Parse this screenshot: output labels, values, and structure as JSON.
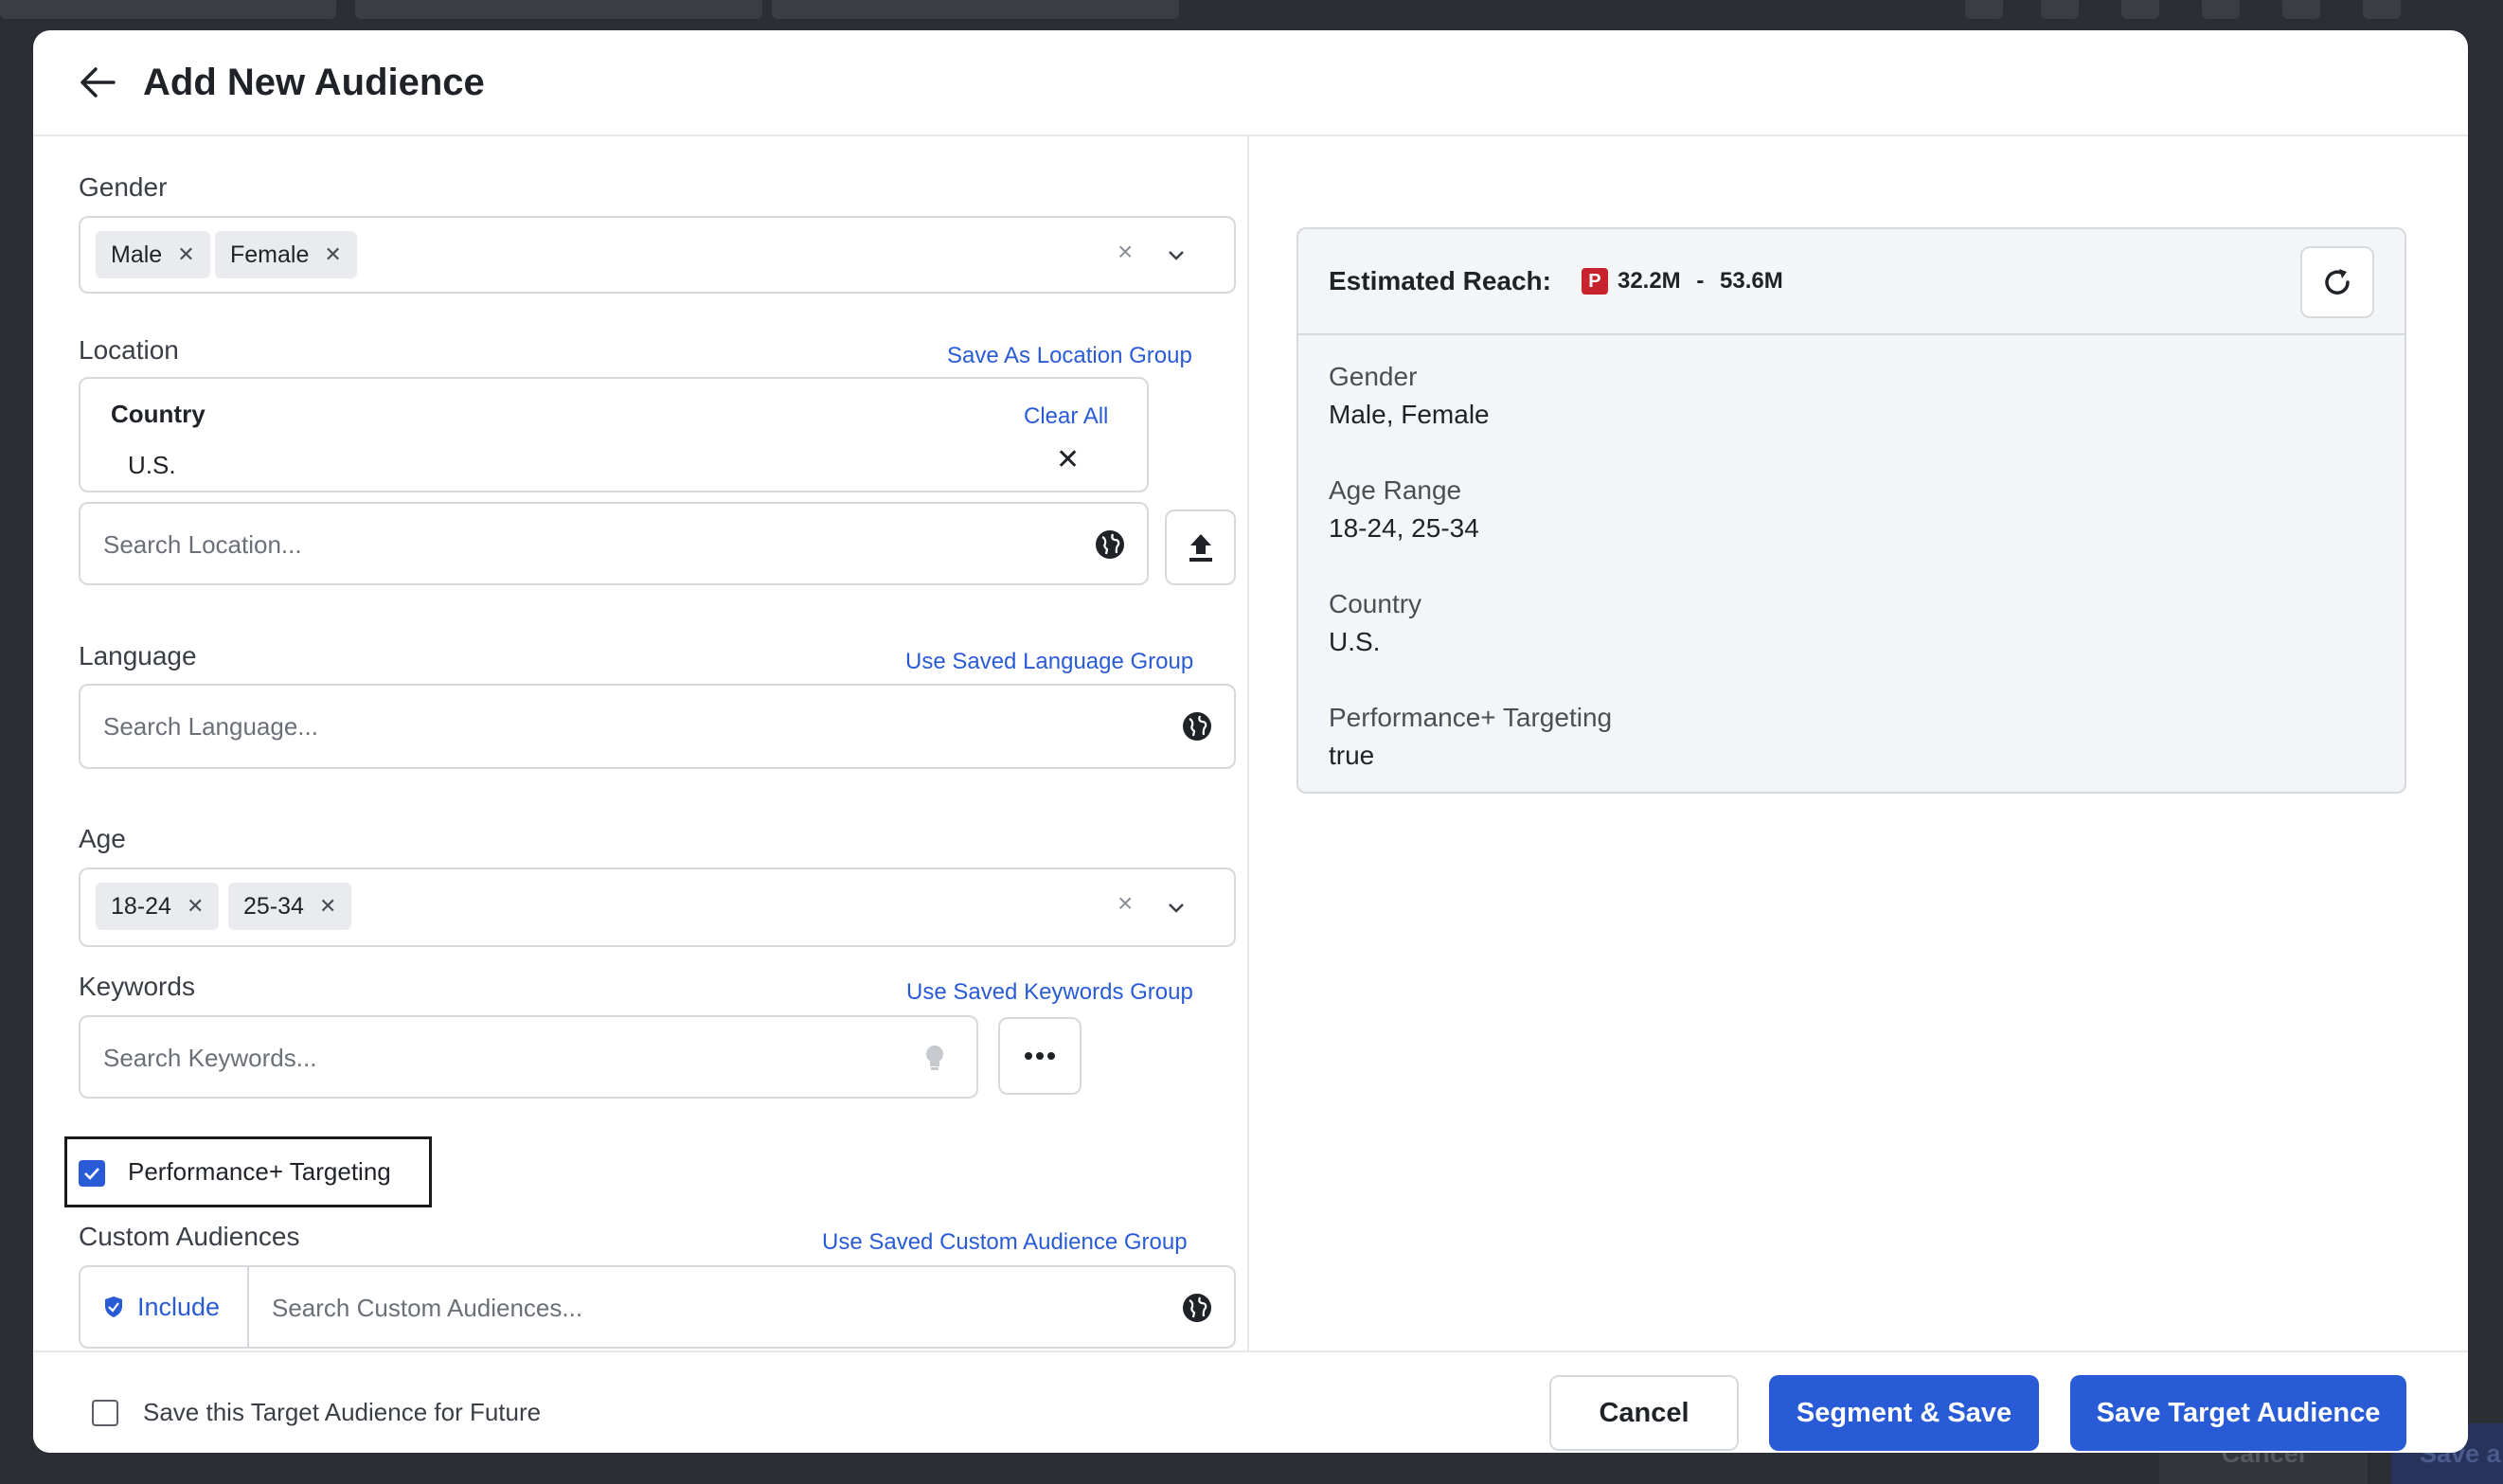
{
  "modal": {
    "title": "Add New Audience"
  },
  "gender": {
    "label": "Gender",
    "chips": [
      "Male",
      "Female"
    ]
  },
  "location": {
    "label": "Location",
    "save_link": "Save As Location Group",
    "country_heading": "Country",
    "clear_all": "Clear All",
    "country_value": "U.S.",
    "search_placeholder": "Search Location..."
  },
  "language": {
    "label": "Language",
    "link": "Use Saved Language Group",
    "search_placeholder": "Search Language..."
  },
  "age": {
    "label": "Age",
    "chips": [
      "18-24",
      "25-34"
    ]
  },
  "keywords": {
    "label": "Keywords",
    "link": "Use Saved Keywords Group",
    "search_placeholder": "Search Keywords..."
  },
  "performance": {
    "label": "Performance+ Targeting",
    "checked": true
  },
  "custom_audiences": {
    "label": "Custom Audiences",
    "link": "Use Saved Custom Audience Group",
    "include_label": "Include",
    "search_placeholder": "Search Custom Audiences..."
  },
  "reach": {
    "title": "Estimated Reach:",
    "platform_icon": "pinterest-icon",
    "platform_color": "#c8232c",
    "range_min": "32.2M",
    "range_sep": " - ",
    "range_max": "53.6M",
    "summary": [
      {
        "label": "Gender",
        "value": "Male, Female"
      },
      {
        "label": "Age Range",
        "value": "18-24, 25-34"
      },
      {
        "label": "Country",
        "value": "U.S."
      },
      {
        "label": "Performance+ Targeting",
        "value": "true"
      }
    ]
  },
  "footer": {
    "save_future_label": "Save this Target Audience for Future",
    "cancel": "Cancel",
    "segment_save": "Segment & Save",
    "save_target": "Save Target Audience"
  },
  "background": {
    "cancel": "Cancel",
    "save": "Save a"
  },
  "colors": {
    "accent": "#2a5bd7",
    "pinterest": "#c8232c"
  }
}
